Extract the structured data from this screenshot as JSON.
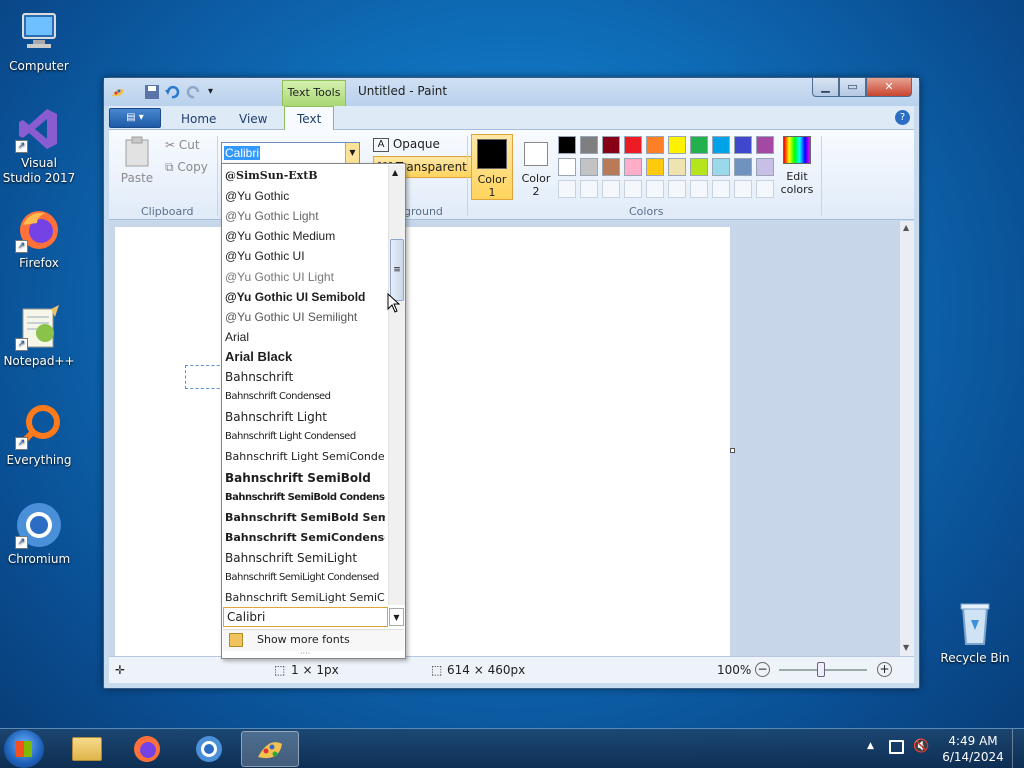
{
  "desktop": {
    "icons": [
      {
        "label": "Computer",
        "icon": "computer-icon"
      },
      {
        "label": "Visual Studio 2017",
        "icon": "visual-studio-icon"
      },
      {
        "label": "Firefox",
        "icon": "firefox-icon"
      },
      {
        "label": "Notepad++",
        "icon": "notepad-plus-plus-icon"
      },
      {
        "label": "Everything",
        "icon": "everything-search-icon"
      },
      {
        "label": "Chromium",
        "icon": "chromium-icon"
      },
      {
        "label": "Recycle Bin",
        "icon": "recycle-bin-icon"
      }
    ]
  },
  "window": {
    "title": "Untitled - Paint",
    "contextual_tab": "Text Tools",
    "tabs": [
      "Home",
      "View",
      "Text"
    ],
    "active_tab": "Text"
  },
  "ribbon": {
    "clipboard": {
      "label": "Clipboard",
      "paste": "Paste",
      "cut": "Cut",
      "copy": "Copy"
    },
    "background": {
      "label": "ground",
      "opaque": "Opaque",
      "transparent": "Transparent"
    },
    "colors": {
      "label": "Colors",
      "color1_label": "Color",
      "color1_num": "1",
      "color2_label": "Color",
      "color2_num": "2",
      "edit_colors_1": "Edit",
      "edit_colors_2": "colors",
      "color1": "#000000",
      "color2": "#ffffff",
      "row1": [
        "#000000",
        "#7f7f7f",
        "#880015",
        "#ed1c24",
        "#ff7f27",
        "#fff200",
        "#22b14c",
        "#00a2e8",
        "#3f48cc",
        "#a349a4"
      ],
      "row2": [
        "#ffffff",
        "#c3c3c3",
        "#b97a57",
        "#ffaec9",
        "#ffc90e",
        "#efe4b0",
        "#b5e61d",
        "#99d9ea",
        "#7092be",
        "#c8bfe7"
      ]
    }
  },
  "font_box": {
    "value": "Calibri"
  },
  "font_dropdown": {
    "items": [
      "@SimSun-ExtB",
      "@Yu Gothic",
      "@Yu Gothic Light",
      "@Yu Gothic Medium",
      "@Yu Gothic UI",
      "@Yu Gothic UI Light",
      "@Yu Gothic UI Semibold",
      "@Yu Gothic UI Semilight",
      "Arial",
      "Arial Black",
      "Bahnschrift",
      "Bahnschrift Condensed",
      "Bahnschrift Light",
      "Bahnschrift Light Condensed",
      "Bahnschrift Light SemiCondensed",
      "Bahnschrift SemiBold",
      "Bahnschrift SemiBold Condensed",
      "Bahnschrift SemiBold SemiCondensed",
      "Bahnschrift SemiCondensed",
      "Bahnschrift SemiLight",
      "Bahnschrift SemiLight Condensed",
      "Bahnschrift SemiLight SemiCondensed"
    ],
    "search_value": "Calibri",
    "show_more": "Show more fonts"
  },
  "statusbar": {
    "selection_size": "1 × 1px",
    "canvas_size": "614 × 460px",
    "zoom": "100%"
  },
  "taskbar": {
    "time": "4:49 AM",
    "date": "6/14/2024"
  }
}
